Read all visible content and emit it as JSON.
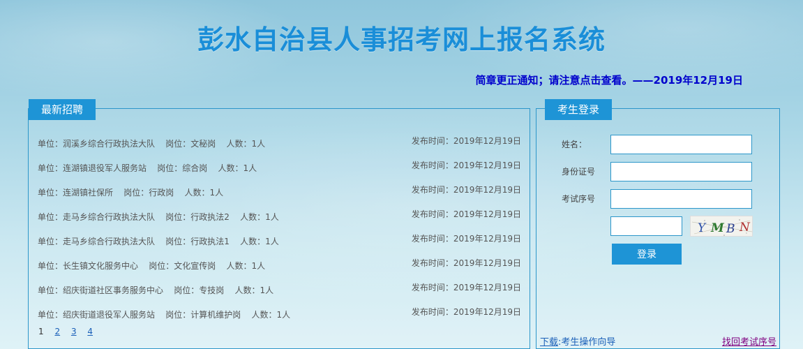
{
  "site": {
    "title": "彭水自治县人事招考网上报名系统",
    "notice": "简章更正通知；请注意点击查看。——2019年12月19日"
  },
  "recruit": {
    "tab_label": "最新招聘",
    "jobs": [
      {
        "info": "单位：润溪乡综合行政执法大队    岗位：文秘岗    人数：1人",
        "date": "发布时间：2019年12月19日"
      },
      {
        "info": "单位：连湖镇退役军人服务站    岗位：综合岗    人数：1人",
        "date": "发布时间：2019年12月19日"
      },
      {
        "info": "单位：连湖镇社保所    岗位：行政岗    人数：1人",
        "date": "发布时间：2019年12月19日"
      },
      {
        "info": "单位：走马乡综合行政执法大队    岗位：行政执法2    人数：1人",
        "date": "发布时间：2019年12月19日"
      },
      {
        "info": "单位：走马乡综合行政执法大队    岗位：行政执法1    人数：1人",
        "date": "发布时间：2019年12月19日"
      },
      {
        "info": "单位：长生镇文化服务中心    岗位：文化宣传岗    人数：1人",
        "date": "发布时间：2019年12月19日"
      },
      {
        "info": "单位：绍庆街道社区事务服务中心    岗位：专技岗    人数：1人",
        "date": "发布时间：2019年12月19日"
      },
      {
        "info": "单位：绍庆街道退役军人服务站    岗位：计算机维护岗    人数：1人",
        "date": "发布时间：2019年12月19日"
      }
    ],
    "pagination": {
      "current": "1",
      "pages": [
        "2",
        "3",
        "4"
      ]
    }
  },
  "login": {
    "tab_label": "考生登录",
    "name_label": "姓名：",
    "name_value": "",
    "id_label": "身份证号",
    "id_value": "",
    "exam_no_label": "考试序号",
    "exam_no_value": "",
    "captcha_value": "",
    "captcha_text": "YMBN",
    "login_button": "登录",
    "download_prefix": "下载",
    "download_guide": ":考生操作向导",
    "recover_link": "找回考试序号"
  },
  "colors": {
    "accent": "#1e94d6",
    "title": "#1a8ed8",
    "notice": "#0000cc",
    "border": "#2c96c9",
    "visited_link": "#800080"
  }
}
